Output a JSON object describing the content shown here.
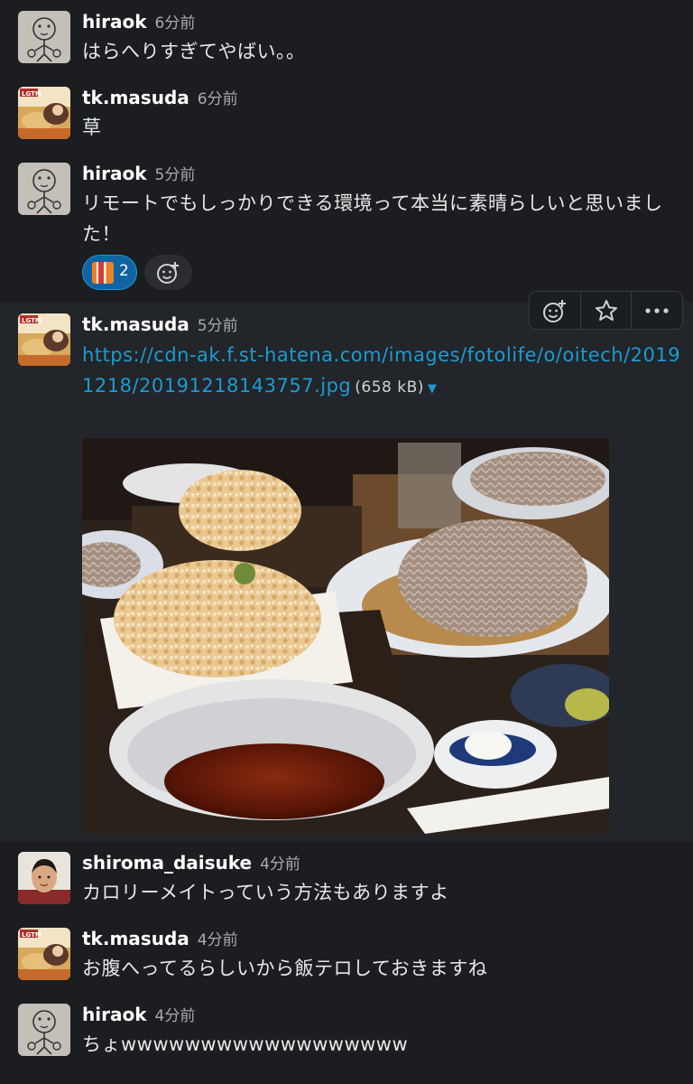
{
  "messages": [
    {
      "user": "hiraok",
      "time": "6分前",
      "text": "はらへりすぎてやばい。。"
    },
    {
      "user": "tk.masuda",
      "time": "6分前",
      "text": "草"
    },
    {
      "user": "hiraok",
      "time": "5分前",
      "text": "リモートでもしっかりできる環境って本当に素晴らしいと思いました！",
      "reactions": [
        {
          "emoji": "emoji-reaction-icon",
          "count": "2"
        }
      ]
    },
    {
      "user": "tk.masuda",
      "time": "5分前",
      "link": "https://cdn-ak.f.st-hatena.com/images/fotolife/o/oitech/20191218/20191218143757.jpg",
      "file_size": "(658 kB)",
      "image_alt": "soba-tempura-photo"
    },
    {
      "user": "shiroma_daisuke",
      "time": "4分前",
      "text": "カロリーメイトっていう方法もありますよ"
    },
    {
      "user": "tk.masuda",
      "time": "4分前",
      "text": "お腹へってるらしいから飯テロしておきますね"
    },
    {
      "user": "hiraok",
      "time": "4分前",
      "text": "ちょwwwwwwwwwwwwwwwwww"
    }
  ],
  "colors": {
    "background": "#1b1d21",
    "link": "#1d9bd1",
    "reaction_active": "#1164a3"
  },
  "toolbar": {
    "icons": [
      "add-reaction-icon",
      "star-icon",
      "more-actions-icon"
    ]
  }
}
